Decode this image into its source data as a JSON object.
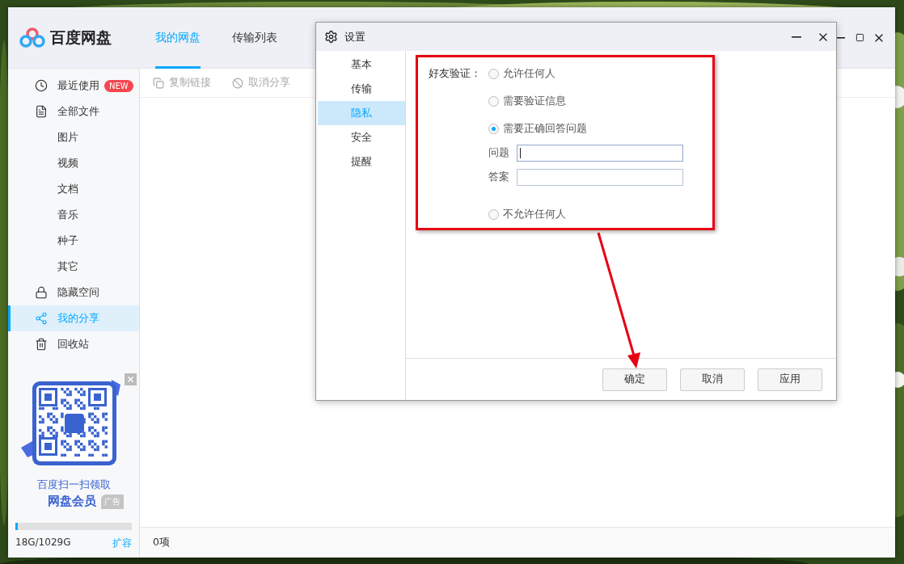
{
  "app": {
    "name": "百度网盘",
    "tabs": [
      {
        "label": "我的网盘",
        "selected": true
      },
      {
        "label": "传输列表",
        "selected": false
      }
    ]
  },
  "sidebar": {
    "items": [
      {
        "label": "最近使用",
        "badge": "NEW",
        "selected": false
      },
      {
        "label": "全部文件",
        "selected": false,
        "children": [
          {
            "label": "图片",
            "selected": false
          },
          {
            "label": "视频",
            "selected": false
          },
          {
            "label": "文档",
            "selected": false
          },
          {
            "label": "音乐",
            "selected": false
          },
          {
            "label": "种子",
            "selected": false
          },
          {
            "label": "其它",
            "selected": false
          }
        ]
      },
      {
        "label": "隐藏空间",
        "selected": false
      },
      {
        "label": "我的分享",
        "selected": true
      },
      {
        "label": "回收站",
        "selected": false
      }
    ]
  },
  "ad": {
    "line1": "百度扫一扫领取",
    "line2": "网盘会员",
    "tag": "广告"
  },
  "storage": {
    "usage": "18G/1029G",
    "level": 0.02,
    "link": "扩容"
  },
  "toolbar": {
    "actions": [
      {
        "label": "复制链接",
        "disabled": true
      },
      {
        "label": "取消分享",
        "disabled": true
      }
    ]
  },
  "status_bar": {
    "count": "0项"
  },
  "dialog": {
    "title": "设置",
    "nav": [
      {
        "label": "基本",
        "selected": false
      },
      {
        "label": "传输",
        "selected": false
      },
      {
        "label": "隐私",
        "selected": true
      },
      {
        "label": "安全",
        "selected": false
      },
      {
        "label": "提醒",
        "selected": false
      }
    ],
    "section_label": "好友验证：",
    "options": [
      {
        "label": "允许任何人",
        "selected": false
      },
      {
        "label": "需要验证信息",
        "selected": false
      },
      {
        "label": "需要正确回答问题",
        "selected": true,
        "fields": [
          {
            "label": "问题",
            "focused": true
          },
          {
            "label": "答案",
            "focused": false
          }
        ]
      },
      {
        "label": "不允许任何人",
        "selected": false
      }
    ],
    "buttons": [
      "确定",
      "取消",
      "应用"
    ]
  }
}
